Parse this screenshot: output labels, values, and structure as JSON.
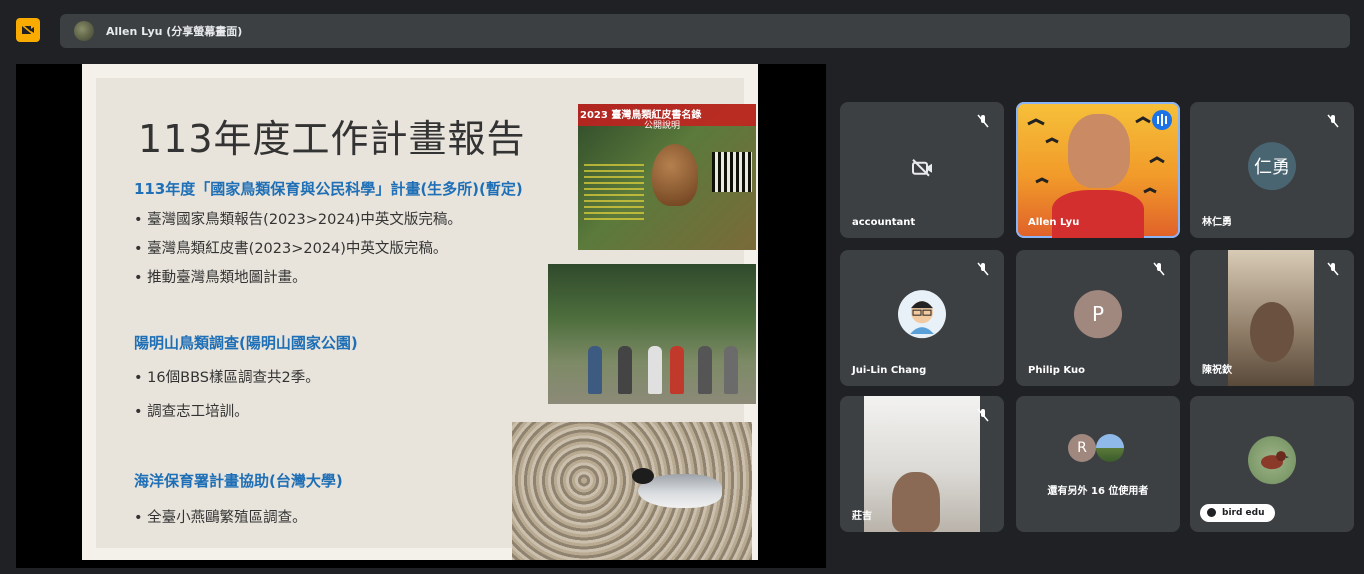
{
  "header": {
    "presenter_label": "Allen Lyu (分享螢幕畫面)"
  },
  "slide": {
    "title": "113年度工作計畫報告",
    "sections": [
      {
        "heading": "113年度「國家鳥類保育與公民科學」計畫(生多所)(暫定)",
        "bullets": [
          "臺灣國家鳥類報告(2023>2024)中英文版完稿。",
          "臺灣鳥類紅皮書(2023>2024)中英文版完稿。",
          "推動臺灣鳥類地圖計畫。"
        ]
      },
      {
        "heading": "陽明山鳥類調查(陽明山國家公園)",
        "bullets": [
          "16個BBS樣區調查共2季。",
          "調查志工培訓。"
        ]
      },
      {
        "heading": "海洋保育署計畫協助(台灣大學)",
        "bullets": [
          "全臺小燕鷗繁殖區調查。"
        ]
      }
    ],
    "poster_title": "2023 臺灣鳥類紅皮書名錄",
    "poster_subtitle": "公開說明"
  },
  "participants": [
    {
      "name": "accountant",
      "type": "camera-off",
      "muted": true
    },
    {
      "name": "Allen Lyu",
      "type": "video",
      "speaking": true
    },
    {
      "name": "林仁勇",
      "type": "initial",
      "initial": "仁勇",
      "avatar_color": "#4a6572",
      "muted": true
    },
    {
      "name": "Jui-Lin Chang",
      "type": "avatar-image",
      "muted": true
    },
    {
      "name": "Philip Kuo",
      "type": "initial",
      "initial": "P",
      "avatar_color": "#a1887f",
      "muted": true
    },
    {
      "name": "陳祝欽",
      "type": "video",
      "muted": true
    },
    {
      "name": "莊吉",
      "type": "video",
      "muted": true
    },
    {
      "name": "",
      "type": "others",
      "more_text": "還有另外 16 位使用者",
      "initial": "R",
      "avatar_color": "#a1887f"
    },
    {
      "name": "bird edu",
      "type": "avatar-image",
      "pill": true
    }
  ],
  "colors": {
    "background": "#202124",
    "tile": "#3c4043",
    "accent": "#f9ab00",
    "speaker_outline": "#8ab4f8",
    "section_heading": "#1f6fb6"
  }
}
